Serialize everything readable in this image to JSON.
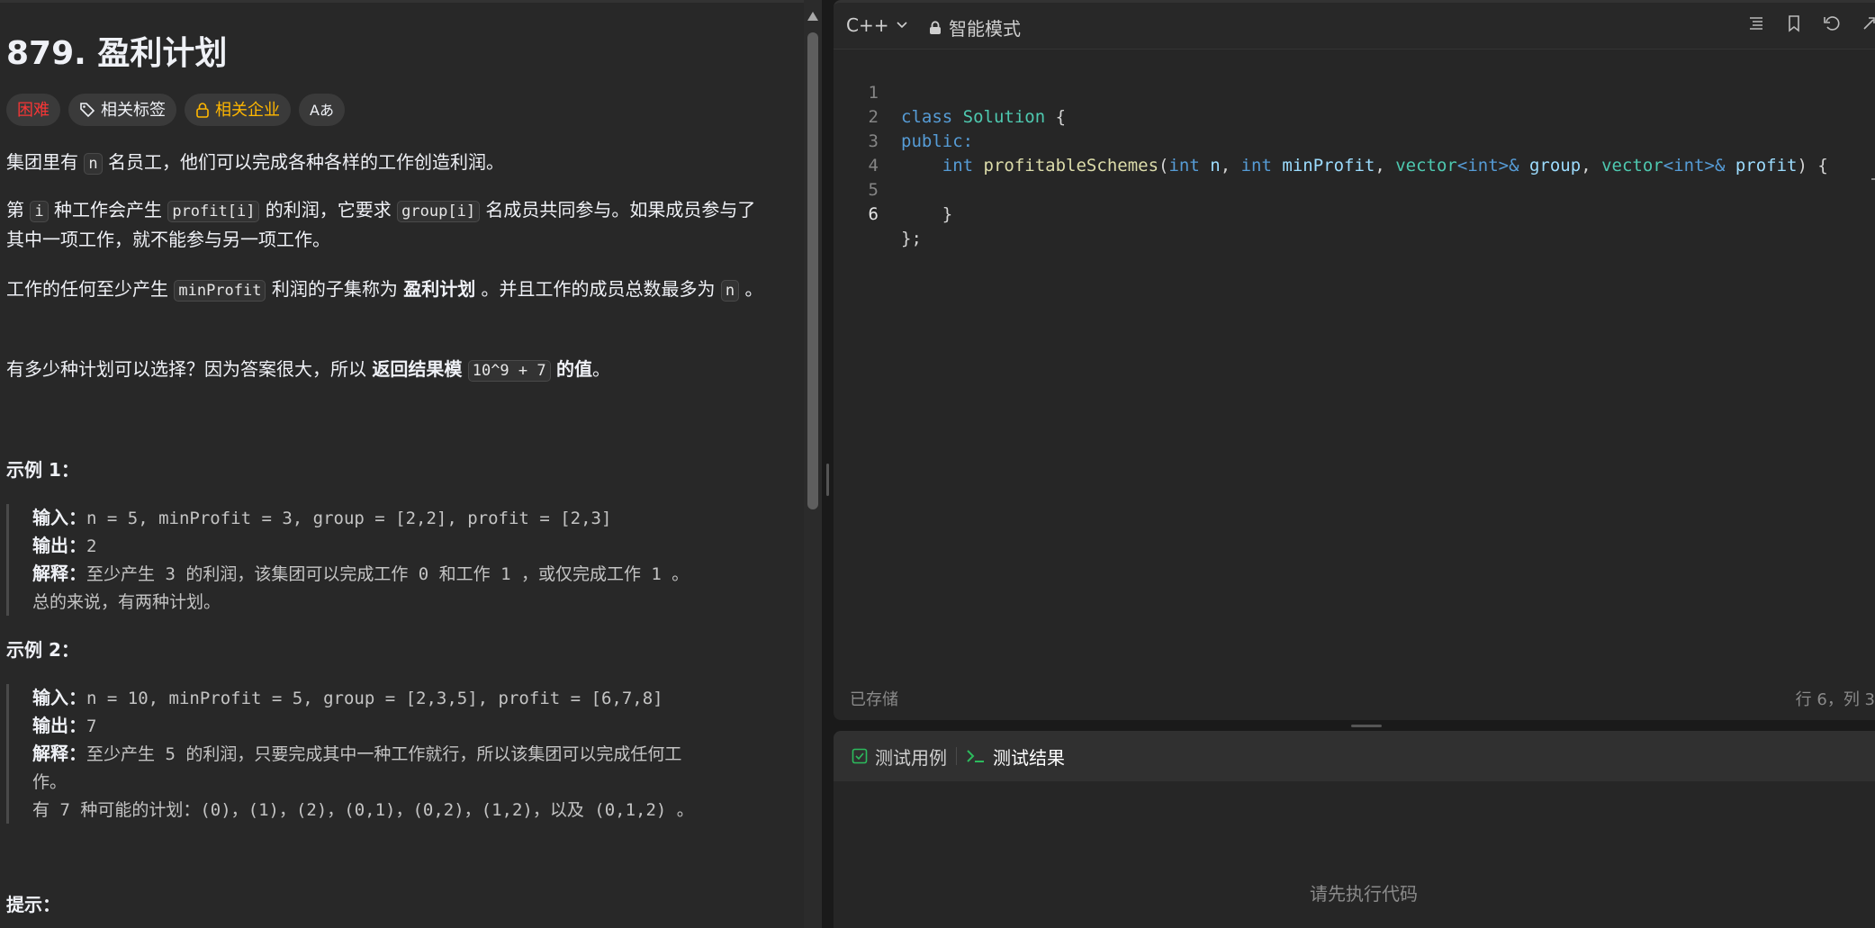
{
  "problem": {
    "title": "879. 盈利计划",
    "tags": {
      "difficulty": "困难",
      "topics": "相关标签",
      "companies": "相关企业",
      "translate": "Aあ"
    },
    "paragraphs": {
      "p1": [
        "集团里有 ",
        "n",
        " 名员工，他们可以完成各种各样的工作创造利润。"
      ],
      "p2": [
        "第 ",
        "i",
        " 种工作会产生 ",
        "profit[i]",
        " 的利润，它要求 ",
        "group[i]",
        " 名成员共同参与。如果成员参与了其中一项工作，就不能参与另一项工作。"
      ],
      "p3": [
        "工作的任何至少产生 ",
        "minProfit",
        " 利润的子集称为 ",
        "盈利计划",
        " 。并且工作的成员总数最多为 ",
        "n",
        " 。"
      ],
      "p4": [
        "有多少种计划可以选择？因为答案很大，所以 ",
        "返回结果模",
        " ",
        "10^9 + 7",
        " ",
        "的值",
        "。"
      ]
    },
    "example1": {
      "heading": "示例 1：",
      "input_label": "输入：",
      "input": "n = 5, minProfit = 3, group = [2,2], profit = [2,3]",
      "output_label": "输出：",
      "output": "2",
      "explain_label": "解释：",
      "explain_1": "至少产生 3 的利润，该集团可以完成工作 0 和工作 1 ，或仅完成工作 1 。",
      "explain_2": "总的来说，有两种计划。"
    },
    "example2": {
      "heading": "示例 2：",
      "input_label": "输入：",
      "input": "n = 10, minProfit = 5, group = [2,3,5], profit = [6,7,8]",
      "output_label": "输出：",
      "output": "7",
      "explain_label": "解释：",
      "explain_1": "至少产生 5 的利润，只要完成其中一种工作就行，所以该集团可以完成任何工",
      "explain_1b": "作。",
      "explain_2": "有 7 种可能的计划：(0)，(1)，(2)，(0,1)，(0,2)，(1,2)，以及 (0,1,2) 。"
    },
    "hints_heading": "提示："
  },
  "editor": {
    "language": "C++",
    "mode": "智能模式",
    "line_numbers": [
      "1",
      "2",
      "3",
      "4",
      "5",
      "6"
    ],
    "code": {
      "l1_kw": "class",
      "l1_name": "Solution",
      "l1_rest": " {",
      "l2": "public:",
      "l3_ret": "int",
      "l3_fn": "profitableSchemes",
      "l3_open": "(",
      "l3_t1": "int",
      "l3_v1": "n",
      "l3_t2": "int",
      "l3_v2": "minProfit",
      "l3_t3": "vector",
      "l3_t3a": "int",
      "l3_v3": "group",
      "l3_t4": "vector",
      "l3_t4a": "int",
      "l3_v4": "profit",
      "l3_close": ") {",
      "l5": "}",
      "l6": "};"
    },
    "status_saved": "已存储",
    "cursor_position": "行 6，列 3"
  },
  "test_panel": {
    "tab_cases": "测试用例",
    "tab_results": "测试结果",
    "empty_message": "请先执行代码"
  },
  "colors": {
    "hard": "#f63636",
    "company": "#ffb700",
    "green": "#2cbb5d"
  }
}
